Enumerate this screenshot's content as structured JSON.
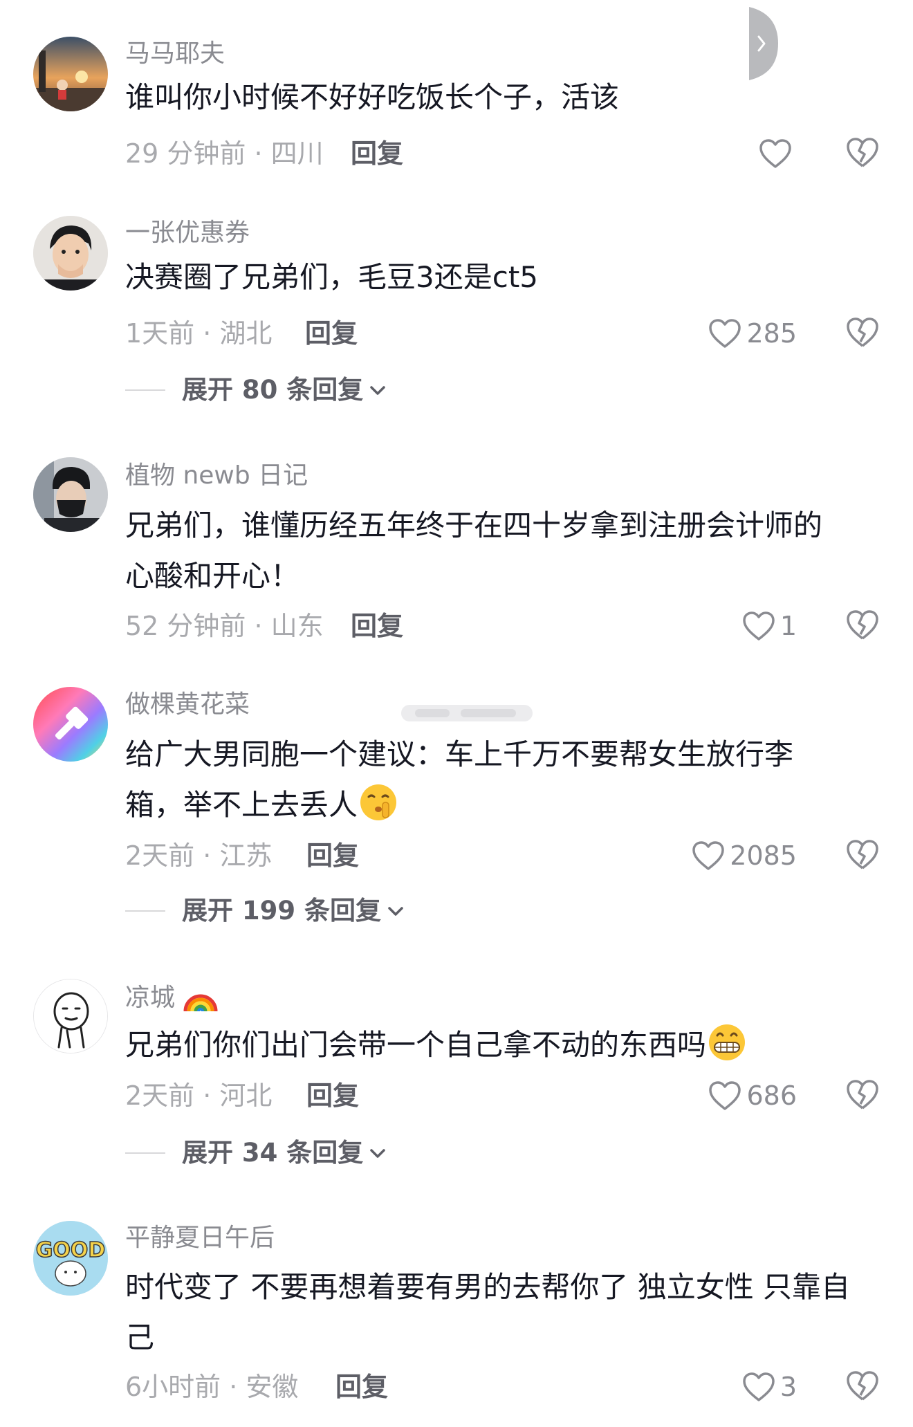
{
  "comments": [
    {
      "username": "马马耶夫",
      "lines": [
        "谁叫你小时候不好好吃饭长个子，活该"
      ],
      "meta": "29 分钟前 · 四川",
      "reply_label": "回复",
      "likes": "",
      "avatar_icon": "sunset-cartoon-avatar"
    },
    {
      "username": "一张优惠券",
      "lines": [
        "决赛圈了兄弟们，毛豆3还是ct5"
      ],
      "meta": "1天前 · 湖北",
      "reply_label": "回复",
      "likes": "285",
      "expand_label": "展开 80 条回复",
      "avatar_icon": "man-hand-on-face-avatar"
    },
    {
      "username": "植物 newb 日记",
      "lines": [
        "兄弟们，谁懂历经五年终于在四十岁拿到注册会计师的",
        "心酸和开心！"
      ],
      "meta": "52 分钟前 · 山东",
      "reply_label": "回复",
      "likes": "1",
      "avatar_icon": "masked-person-avatar"
    },
    {
      "username": "做棵黄花菜",
      "lines": [
        "给广大男同胞一个建议：车上千万不要帮女生放行李",
        "箱，举不上去丢人"
      ],
      "meta": "2天前 · 江苏",
      "reply_label": "回复",
      "likes": "2085",
      "expand_label": "展开 199 条回复",
      "avatar_icon": "rainbow-gradient-avatar",
      "emoji_icon": "shushing-face-emoji"
    },
    {
      "username": "凉城",
      "username_emoji": "rainbow-emoji",
      "lines": [
        "兄弟们你们出门会带一个自己拿不动的东西吗"
      ],
      "meta": "2天前 · 河北",
      "reply_label": "回复",
      "likes": "686",
      "expand_label": "展开 34 条回复",
      "avatar_icon": "line-drawing-face-avatar",
      "emoji_icon": "grinning-face-emoji"
    },
    {
      "username": "平静夏日午后",
      "lines": [
        "时代变了 不要再想着要有男的去帮你了 独立女性 只靠自",
        "己"
      ],
      "meta": "6小时前 · 安徽",
      "reply_label": "回复",
      "likes": "3",
      "avatar_icon": "good-sheep-avatar"
    }
  ],
  "icons": {
    "like": "heart-outline-icon",
    "dislike": "broken-heart-icon",
    "expand": "chevron-down-icon",
    "side_tab": "chevron-right-icon"
  },
  "colors": {
    "username": "#8a8b91",
    "text": "#161823",
    "meta": "#a8a9ad",
    "reply": "#5d5e66"
  }
}
